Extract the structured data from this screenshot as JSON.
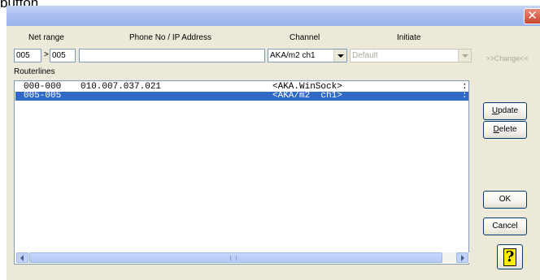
{
  "caption": "button.",
  "window": {
    "close_glyph": "✕"
  },
  "form": {
    "net_range_label": "Net range",
    "phone_label": "Phone No / IP Address",
    "channel_label": "Channel",
    "initiate_label": "Initiate",
    "net_from": "005",
    "range_arrow": ">",
    "net_to": "005",
    "phone_value": "",
    "channel_value": "AKA/m2 ch1",
    "initiate_value": "Default",
    "change_label": ">>Change<<"
  },
  "routerlines": {
    "label": "Routerlines",
    "rows": [
      {
        "range": "000-000",
        "address": "010.007.037.021",
        "channel": "<AKA.WinSock>",
        "flag": ":",
        "selected": false
      },
      {
        "range": "005-005",
        "address": "",
        "channel": "<AKA/m2  ch1>",
        "flag": ":",
        "selected": true
      }
    ]
  },
  "buttons": {
    "update": {
      "pre": "",
      "key": "U",
      "post": "pdate"
    },
    "delete": {
      "pre": "",
      "key": "D",
      "post": "elete"
    },
    "ok": "OK",
    "cancel": "Cancel",
    "help_glyph": "?"
  },
  "colors": {
    "selection": "#316ac5",
    "dialog_bg": "#ece9d8",
    "titlebar": "#a9bff0",
    "close_button": "#c8452c"
  },
  "icons": [
    "close-icon",
    "combo-arrow-icon",
    "scroll-left-icon",
    "scroll-right-icon",
    "help-icon"
  ]
}
